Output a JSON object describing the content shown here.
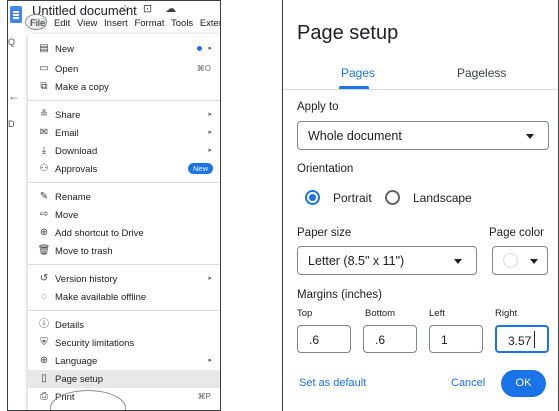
{
  "docs": {
    "title": "Untitled document",
    "title_icons": "☆ ⊡ ☁",
    "menubar": [
      "File",
      "Edit",
      "View",
      "Insert",
      "Format",
      "Tools",
      "Extensi"
    ],
    "edge_glyphs": [
      "Q",
      "←",
      "D"
    ]
  },
  "file_menu": {
    "items": [
      {
        "icon": "▤",
        "label": "New"
      },
      {
        "icon": "▭",
        "label": "Open",
        "shortcut": "⌘O"
      },
      {
        "icon": "⧉",
        "label": "Make a copy"
      },
      {
        "icon": "≗",
        "label": "Share"
      },
      {
        "icon": "✉",
        "label": "Email"
      },
      {
        "icon": "⤓",
        "label": "Download"
      },
      {
        "icon": "⚇",
        "label": "Approvals",
        "badge": "New"
      },
      {
        "icon": "✎",
        "label": "Rename"
      },
      {
        "icon": "⇨",
        "label": "Move"
      },
      {
        "icon": "⊕",
        "label": "Add shortcut to Drive"
      },
      {
        "icon": "🗑",
        "label": "Move to trash"
      },
      {
        "icon": "↺",
        "label": "Version history"
      },
      {
        "icon": "◌",
        "label": "Make available offline"
      },
      {
        "icon": "ⓘ",
        "label": "Details"
      },
      {
        "icon": "⛨",
        "label": "Security limitations"
      },
      {
        "icon": "⊕",
        "label": "Language"
      },
      {
        "icon": "▯",
        "label": "Page setup"
      },
      {
        "icon": "⎙",
        "label": "Print",
        "shortcut": "⌘P"
      }
    ],
    "submenu_arrow": "▸"
  },
  "page_setup": {
    "title": "Page setup",
    "tabs": [
      "Pages",
      "Pageless"
    ],
    "apply_to": {
      "label": "Apply to",
      "value": "Whole document"
    },
    "orientation": {
      "label": "Orientation",
      "options": [
        "Portrait",
        "Landscape"
      ],
      "selected": "Portrait"
    },
    "paper_size": {
      "label": "Paper size",
      "value": "Letter (8.5\" x 11\")"
    },
    "page_color": {
      "label": "Page color",
      "value": "#ffffff"
    },
    "margins": {
      "label": "Margins (inches)",
      "top": {
        "label": "Top",
        "value": ".6"
      },
      "bottom": {
        "label": "Bottom",
        "value": ".6"
      },
      "left": {
        "label": "Left",
        "value": "1"
      },
      "right": {
        "label": "Right",
        "value": "3.57"
      }
    },
    "buttons": {
      "set_default": "Set as default",
      "cancel": "Cancel",
      "ok": "OK"
    }
  },
  "colors": {
    "accent": "#1a73e8"
  }
}
